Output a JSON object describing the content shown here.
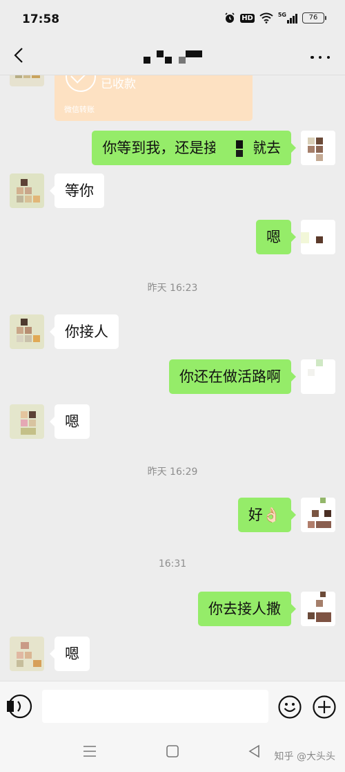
{
  "status_bar": {
    "time": "17:58",
    "hd_label": "HD",
    "signal_label": "5G",
    "battery": "76"
  },
  "nav": {
    "title": ""
  },
  "transfer": {
    "status": "已收款",
    "footer": "微信转账"
  },
  "messages": [
    {
      "side": "right",
      "text": "你等到我，还是接了李  就去"
    },
    {
      "side": "left",
      "text": "等你"
    },
    {
      "side": "right",
      "text": "嗯"
    },
    {
      "side": "left",
      "text": "你接人"
    },
    {
      "side": "right",
      "text": "你还在做活路啊"
    },
    {
      "side": "left",
      "text": "嗯"
    },
    {
      "side": "right",
      "text": "好👌🏻"
    },
    {
      "side": "right",
      "text": "你去接人撒"
    },
    {
      "side": "left",
      "text": "嗯"
    }
  ],
  "timestamps": [
    "昨天 16:23",
    "昨天 16:29",
    "16:31"
  ],
  "input": {
    "value": "",
    "placeholder": ""
  },
  "watermark": "知乎 @大头头",
  "colors": {
    "background": "#ededed",
    "sent_bubble": "#95ec69",
    "received_bubble": "#ffffff",
    "transfer_card": "#fde1c2"
  }
}
